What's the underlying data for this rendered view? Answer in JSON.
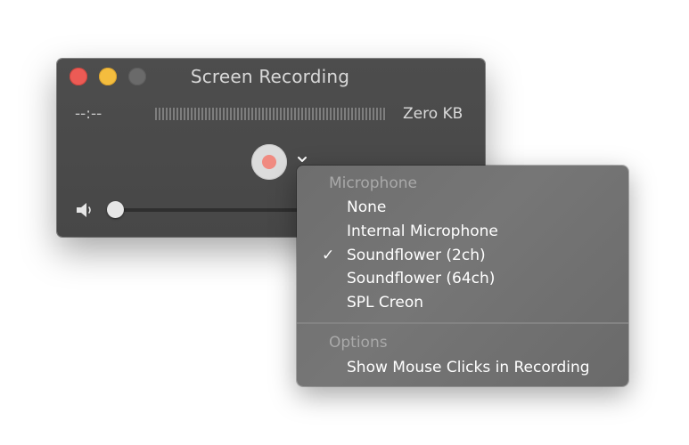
{
  "window": {
    "title": "Screen Recording",
    "time_display": "--:--",
    "file_size": "Zero KB",
    "volume_level": 0.0
  },
  "menu": {
    "microphone_header": "Microphone",
    "microphone_items": [
      {
        "label": "None",
        "checked": false
      },
      {
        "label": "Internal Microphone",
        "checked": false
      },
      {
        "label": "Soundflower (2ch)",
        "checked": true
      },
      {
        "label": "Soundflower (64ch)",
        "checked": false
      },
      {
        "label": "SPL Creon",
        "checked": false
      }
    ],
    "checkmark": "✓",
    "options_header": "Options",
    "options_items": [
      {
        "label": "Show Mouse Clicks in Recording"
      }
    ]
  },
  "colors": {
    "record_accent": "#f08a80",
    "close": "#ec5b55",
    "minimize": "#f4bd3e"
  }
}
